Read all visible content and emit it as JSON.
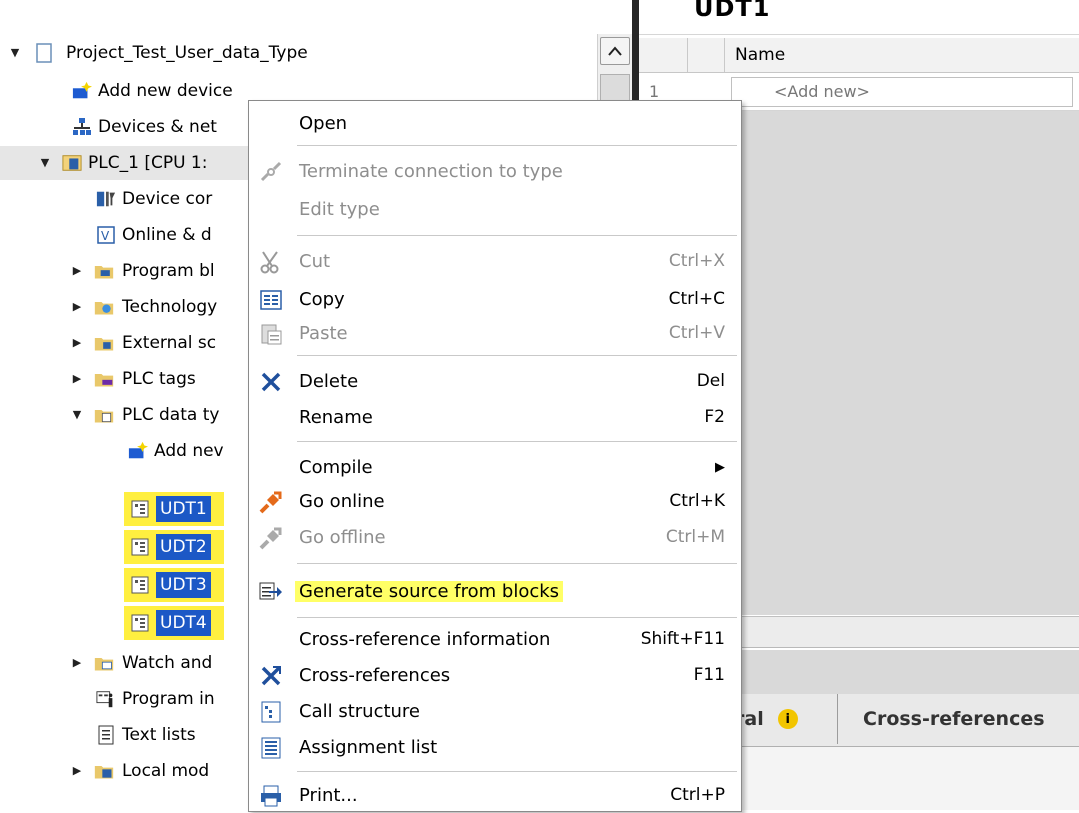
{
  "tree": {
    "items": [
      {
        "label": "Project_Test_User_data_Type",
        "icon": "project-icon"
      },
      {
        "label": "Add new device",
        "icon": "add-device-icon"
      },
      {
        "label": "Devices & net",
        "icon": "network-icon"
      },
      {
        "label": "PLC_1 [CPU 1:",
        "icon": "plc-icon"
      },
      {
        "label": "Device cor",
        "icon": "device-config-icon"
      },
      {
        "label": "Online & d",
        "icon": "online-diagnostics-icon"
      },
      {
        "label": "Program bl",
        "icon": "program-blocks-folder-icon"
      },
      {
        "label": "Technology",
        "icon": "technology-folder-icon"
      },
      {
        "label": "External sc",
        "icon": "external-source-folder-icon"
      },
      {
        "label": "PLC tags",
        "icon": "plc-tags-folder-icon"
      },
      {
        "label": "PLC data ty",
        "icon": "plc-datatypes-folder-icon"
      },
      {
        "label": "Add nev",
        "icon": "add-new-icon"
      },
      {
        "label": "UDT1",
        "icon": "udt-icon"
      },
      {
        "label": "UDT2",
        "icon": "udt-icon"
      },
      {
        "label": "UDT3",
        "icon": "udt-icon"
      },
      {
        "label": "UDT4",
        "icon": "udt-icon"
      },
      {
        "label": "Watch and",
        "icon": "watch-folder-icon"
      },
      {
        "label": "Program in",
        "icon": "program-info-icon"
      },
      {
        "label": "Text lists",
        "icon": "text-lists-icon"
      },
      {
        "label": "Local mod",
        "icon": "local-modules-icon"
      }
    ]
  },
  "editor": {
    "title": "UDT1",
    "column_name": "Name",
    "row_number": "1",
    "add_new": "<Add new>",
    "inspector_tabs": [
      "ral",
      "Cross-references"
    ]
  },
  "menu": {
    "items": [
      {
        "label": "Open",
        "shortcut": "",
        "disabled": false
      },
      {
        "label": "Terminate connection to type",
        "shortcut": "",
        "disabled": true
      },
      {
        "label": "Edit type",
        "shortcut": "",
        "disabled": true
      },
      {
        "label": "Cut",
        "shortcut": "Ctrl+X",
        "disabled": true
      },
      {
        "label": "Copy",
        "shortcut": "Ctrl+C",
        "disabled": false
      },
      {
        "label": "Paste",
        "shortcut": "Ctrl+V",
        "disabled": true
      },
      {
        "label": "Delete",
        "shortcut": "Del",
        "disabled": false
      },
      {
        "label": "Rename",
        "shortcut": "F2",
        "disabled": false
      },
      {
        "label": "Compile",
        "shortcut": "",
        "disabled": false
      },
      {
        "label": "Go online",
        "shortcut": "Ctrl+K",
        "disabled": false
      },
      {
        "label": "Go offline",
        "shortcut": "Ctrl+M",
        "disabled": true
      },
      {
        "label": "Generate source from blocks",
        "shortcut": "",
        "disabled": false
      },
      {
        "label": "Cross-reference information",
        "shortcut": "Shift+F11",
        "disabled": false
      },
      {
        "label": "Cross-references",
        "shortcut": "F11",
        "disabled": false
      },
      {
        "label": "Call structure",
        "shortcut": "",
        "disabled": false
      },
      {
        "label": "Assignment list",
        "shortcut": "",
        "disabled": false
      },
      {
        "label": "Print...",
        "shortcut": "Ctrl+P",
        "disabled": false
      }
    ],
    "highlight_color": "#ffff66",
    "selection_color": "#1c58c6",
    "udt_highlight_color": "#ffef40"
  }
}
